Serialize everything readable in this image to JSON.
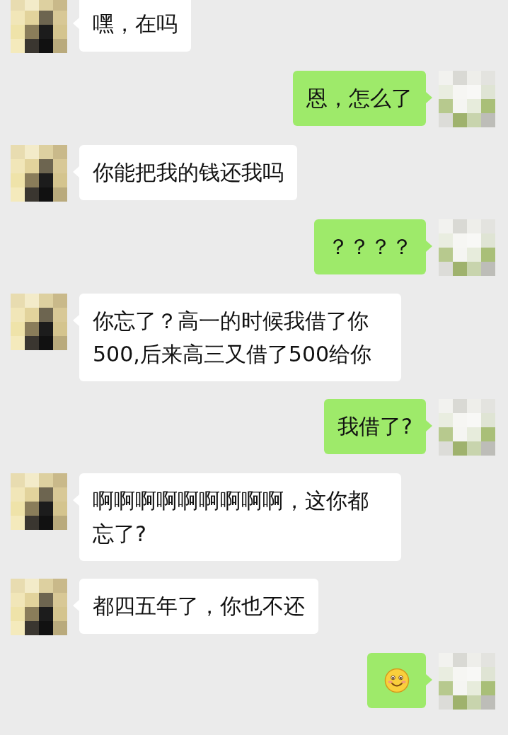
{
  "messages": [
    {
      "outgoing": false,
      "kind": "text",
      "text": "嘿，在吗"
    },
    {
      "outgoing": true,
      "kind": "text",
      "text": "恩，怎么了"
    },
    {
      "outgoing": false,
      "kind": "text",
      "text": "你能把我的钱还我吗"
    },
    {
      "outgoing": true,
      "kind": "text",
      "text": "？？？？"
    },
    {
      "outgoing": false,
      "kind": "text",
      "text": "你忘了？高一的时候我借了你500,后来高三又借了500给你"
    },
    {
      "outgoing": true,
      "kind": "text",
      "text": "我借了?"
    },
    {
      "outgoing": false,
      "kind": "text",
      "text": "啊啊啊啊啊啊啊啊啊，这你都忘了?"
    },
    {
      "outgoing": false,
      "kind": "text",
      "text": "都四五年了，你也不还"
    },
    {
      "outgoing": true,
      "kind": "emoji"
    }
  ]
}
